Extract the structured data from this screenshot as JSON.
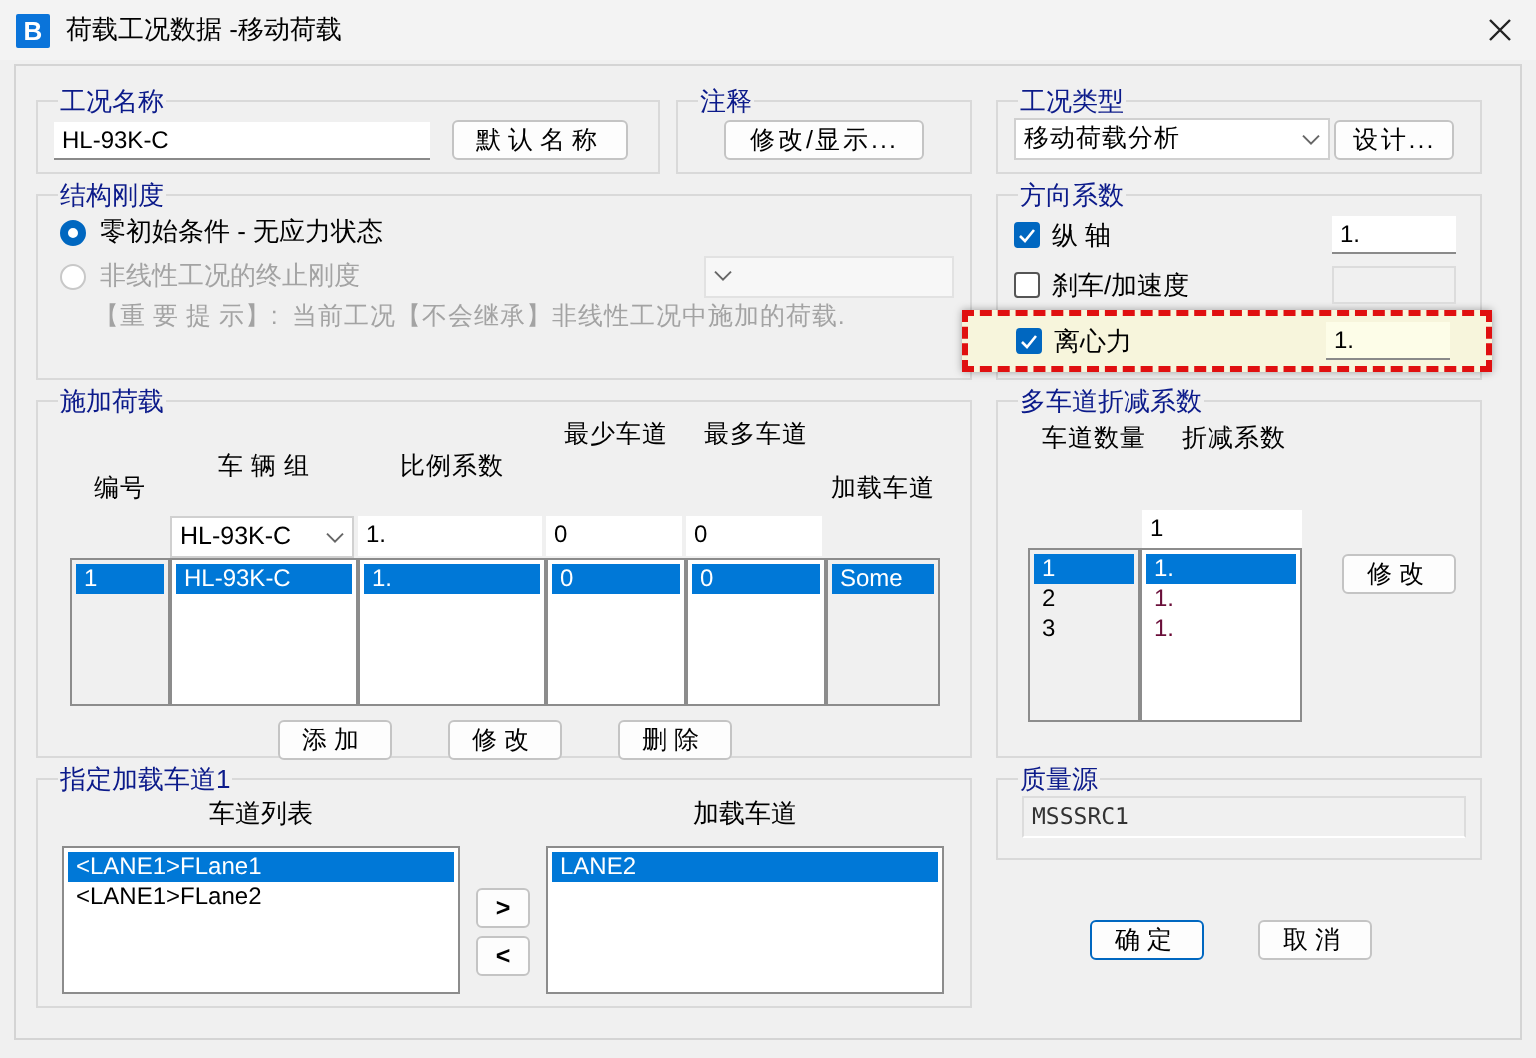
{
  "window": {
    "logo": "B",
    "title": "荷载工况数据 -移动荷载"
  },
  "load_case_name": {
    "label": "工况名称",
    "value": "HL-93K-C",
    "button": "默认名称"
  },
  "notes": {
    "label": "注释",
    "button": "修改/显示..."
  },
  "load_case_type": {
    "label": "工况类型",
    "value": "移动荷载分析",
    "button": "设计..."
  },
  "stiffness": {
    "label": "结构刚度",
    "options": [
      {
        "label": "零初始条件 - 无应力状态",
        "selected": true,
        "disabled": false
      },
      {
        "label": "非线性工况的终止刚度",
        "selected": false,
        "disabled": true
      }
    ],
    "note": "【重 要 提 示】:  当前工况【不会继承】非线性工况中施加的荷载."
  },
  "direction_factors": {
    "label": "方向系数",
    "items": [
      {
        "label": "纵 轴",
        "checked": true,
        "value": "1.",
        "highlighted": false
      },
      {
        "label": "刹车/加速度",
        "checked": false,
        "highlighted": false
      },
      {
        "label": "离心力",
        "checked": true,
        "value": "1.",
        "highlighted": true
      }
    ]
  },
  "applied_loads": {
    "label": "施加荷载",
    "columns": [
      "编号",
      "车 辆 组",
      "比例系数",
      "最少车道",
      "最多车道",
      "加载车道"
    ],
    "edit_row": {
      "vehicle": "HL-93K-C",
      "scale": "1.",
      "min_lanes": "0",
      "max_lanes": "0"
    },
    "rows": [
      {
        "cells": [
          "1",
          "HL-93K-C",
          "1.",
          "0",
          "0",
          "Some"
        ],
        "selected": true
      }
    ],
    "buttons": [
      "添加",
      "修改",
      "删除"
    ]
  },
  "lane_reduction": {
    "label": "多车道折减系数",
    "columns": [
      "车道数量",
      "折减系数"
    ],
    "edit_value": "1",
    "rows": [
      {
        "lanes": "1",
        "factor": "1.",
        "selected": true
      },
      {
        "lanes": "2",
        "factor": "1.",
        "selected": false
      },
      {
        "lanes": "3",
        "factor": "1.",
        "selected": false
      }
    ],
    "button": "修改"
  },
  "mass_source": {
    "label": "质量源",
    "value": "MSSSRC1"
  },
  "lane_assignment": {
    "label": "指定加载车道1",
    "available": {
      "label": "车道列表",
      "items": [
        {
          "text": "<LANE1>FLane1",
          "selected": true
        },
        {
          "text": "<LANE1>FLane2",
          "selected": false
        }
      ]
    },
    "move_buttons": [
      ">",
      "<"
    ],
    "loaded": {
      "label": "加载车道",
      "items": [
        {
          "text": "LANE2",
          "selected": true
        }
      ]
    }
  },
  "dialog_buttons": [
    {
      "label": "确定",
      "default": true
    },
    {
      "label": "取消",
      "default": false
    }
  ]
}
